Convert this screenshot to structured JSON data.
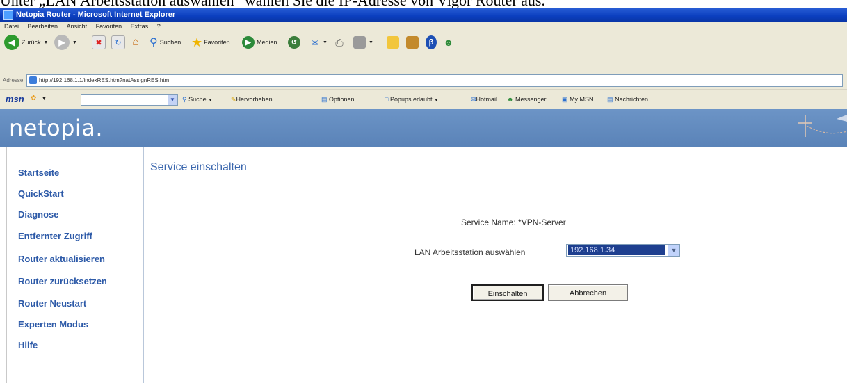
{
  "caption": "Unter „LAN Arbeitsstation auswählen“ wählen Sie die IP-Adresse von Vigor Router aus.",
  "window": {
    "title": "Netopia Router - Microsoft Internet Explorer"
  },
  "menu": [
    "Datei",
    "Bearbeiten",
    "Ansicht",
    "Favoriten",
    "Extras",
    "?"
  ],
  "toolbar": {
    "back": "Zurück",
    "search": "Suchen",
    "favorites": "Favoriten",
    "media": "Medien"
  },
  "address": {
    "label": "Adresse",
    "url": "http://192.168.1.1/indexRES.htm?natAssignRES.htm"
  },
  "msn": {
    "logo": "msn",
    "search": "Suche",
    "highlight": "Hervorheben",
    "options": "Optionen",
    "popups": "Popups erlaubt",
    "hotmail": "Hotmail",
    "messenger": "Messenger",
    "mymsn": "My MSN",
    "news": "Nachrichten"
  },
  "brand": {
    "logo": "netopia."
  },
  "nav": [
    "Startseite",
    "QuickStart",
    "Diagnose",
    "Entfernter Zugriff",
    "Router aktualisieren",
    "Router zurücksetzen",
    "Router Neustart",
    "Experten Modus",
    "Hilfe"
  ],
  "content": {
    "title": "Service einschalten",
    "service_name": "Service Name: *VPN-Server",
    "lan_label": "LAN Arbeitsstation auswählen",
    "selected_ip": "192.168.1.34",
    "enable_button": "Einschalten",
    "cancel_button": "Abbrechen"
  },
  "colors": {
    "titlebar": "#0b3fbf",
    "banner": "#6c94c6",
    "nav_link": "#2d5aa8",
    "content_title": "#3a66ad"
  }
}
